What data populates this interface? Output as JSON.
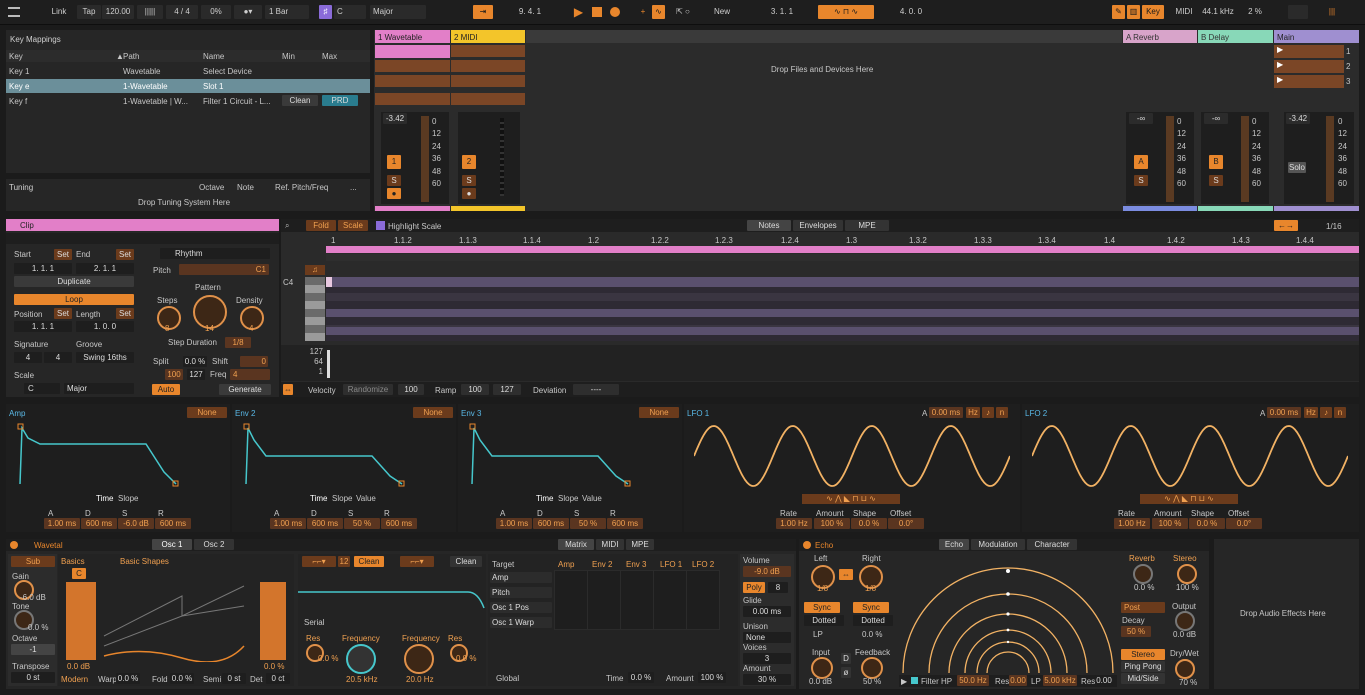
{
  "topbar": {
    "link": "Link",
    "tap": "Tap",
    "bpm": "120.00",
    "sig": "4 / 4",
    "swing": "0%",
    "quant": "1 Bar",
    "key": "C",
    "scale": "Major",
    "pos": "9.  4.  1",
    "new": "New",
    "loop_start": "3.  1.  1",
    "loop_len": "4.  0.  0",
    "key_btn": "Key",
    "midi": "MIDI",
    "rate": "44.1 kHz",
    "cpu": "2 %"
  },
  "keymap": {
    "title": "Key Mappings",
    "cols": [
      "Key",
      "Path",
      "Name",
      "Min",
      "Max"
    ],
    "rows": [
      [
        "Key 1",
        "Wavetable",
        "Select Device",
        "",
        ""
      ],
      [
        "Key e",
        "1-Wavetable",
        "Slot 1",
        "",
        ""
      ],
      [
        "Key f",
        "1-Wavetable | W...",
        "Filter 1 Circuit - L...",
        "Clean",
        "PRD"
      ]
    ]
  },
  "tuning": {
    "title": "Tuning",
    "cols": [
      "Octave",
      "Note",
      "Ref. Pitch/Freq",
      "..."
    ],
    "drop": "Drop Tuning System Here"
  },
  "tracks": {
    "t1": "1 Wavetable",
    "t2": "2 MIDI",
    "drop": "Drop Files and Devices Here",
    "ra": "A Reverb",
    "rb": "B Delay",
    "main": "Main",
    "vol1": "-3.42",
    "vol2": "-∞",
    "vol3": "-∞",
    "vol4": "-3.42",
    "n1": "1",
    "n2": "2",
    "na": "A",
    "nb": "B",
    "s": "S",
    "solo": "Solo",
    "scenes": [
      "1",
      "2",
      "3"
    ],
    "meter": [
      "0",
      "12",
      "24",
      "36",
      "48",
      "60"
    ]
  },
  "clip": {
    "title": "Clip",
    "start": "Start",
    "end": "End",
    "set": "Set",
    "s1": "1.  1.  1",
    "e1": "2.  1.  1",
    "dup": "Duplicate",
    "loop": "Loop",
    "position": "Position",
    "length": "Length",
    "p1": "1.  1.  1",
    "l1": "1.  0.  0",
    "signature": "Signature",
    "groove": "Groove",
    "sig_n": "4",
    "sig_d": "4",
    "swing": "Swing 16ths",
    "scale": "Scale",
    "sk": "C",
    "ss": "Major"
  },
  "rhythm": {
    "mode": "Rhythm",
    "pitch": "Pitch",
    "pitch_v": "C1",
    "steps": "Steps",
    "pattern": "Pattern",
    "density": "Density",
    "steps_v": "8",
    "pattern_v": "14",
    "density_v": "4",
    "step_dur": "Step Duration",
    "step_dur_v": "1/8",
    "split": "Split",
    "split_v": "0.0 %",
    "shift": "Shift",
    "shift_v": "0",
    "v100": "100",
    "v127": "127",
    "freq": "Freq",
    "freq_v": "4",
    "auto": "Auto",
    "gen": "Generate"
  },
  "midi": {
    "fold": "Fold",
    "scale": "Scale",
    "hl": "Highlight Scale",
    "tabs": [
      "Notes",
      "Envelopes",
      "MPE"
    ],
    "grid": "1/16",
    "bars": [
      "1",
      "1.1.2",
      "1.1.3",
      "1.1.4",
      "1.2",
      "1.2.2",
      "1.2.3",
      "1.2.4",
      "1.3",
      "1.3.2",
      "1.3.3",
      "1.3.4",
      "1.4",
      "1.4.2",
      "1.4.3",
      "1.4.4"
    ],
    "note": "C4",
    "vel": [
      "127",
      "64",
      "1"
    ],
    "velocity": "Velocity",
    "randomize": "Randomize",
    "v100": "100",
    "ramp": "Ramp",
    "r100": "100",
    "r127": "127",
    "deviation": "Deviation",
    "dev_v": "----"
  },
  "mods": {
    "env1": "Amp",
    "env2": "Env 2",
    "env3": "Env 3",
    "none": "None",
    "time": "Time",
    "slope": "Slope",
    "value": "Value",
    "A": "A",
    "D": "D",
    "S": "S",
    "R": "R",
    "e1v": [
      "1.00 ms",
      "600 ms",
      "-6.0 dB",
      "600 ms"
    ],
    "e2v": [
      "1.00 ms",
      "600 ms",
      "50 %",
      "600 ms"
    ],
    "e3v": [
      "1.00 ms",
      "600 ms",
      "50 %",
      "600 ms"
    ],
    "lfo1": "LFO 1",
    "lfo2": "LFO 2",
    "la": "A",
    "lav": "0.00 ms",
    "hz": "Hz",
    "rate": "Rate",
    "amount": "Amount",
    "shape": "Shape",
    "offset": "Offset",
    "ratev": "1.00 Hz",
    "amtv": "100 %",
    "shpv": "0.0 %",
    "offv": "0.0°"
  },
  "wt": {
    "title": "Wavetal",
    "osc1": "Osc 1",
    "osc2": "Osc 2",
    "sub": "Sub",
    "gain": "Gain",
    "gain_v": "-6.0 dB",
    "tone": "Tone",
    "tone_v": "0.0 %",
    "octave": "Octave",
    "oct_v": "-1",
    "transpose": "Transpose",
    "trans_v": "0 st",
    "basics": "Basics",
    "shapes": "Basic Shapes",
    "c": "C",
    "osc_v": "0.0 dB",
    "modern": "Modern",
    "warp": "Warp",
    "warp_v": "0.0 %",
    "fold": "Fold",
    "fold_v": "0.0 %",
    "semi": "Semi",
    "semi_v": "0 st",
    "det": "Det",
    "det_v": "0 ct",
    "vol2": "0.0 %",
    "f_num": "12",
    "clean": "Clean",
    "clean2": "Clean",
    "serial": "Serial",
    "res": "Res",
    "res_v": "0.0 %",
    "freq": "Frequency",
    "freq_v": "20.5 kHz",
    "freq2_v": "20.0 Hz",
    "res2_v": "0.0 %",
    "mtabs": [
      "Matrix",
      "MIDI",
      "MPE"
    ],
    "target": "Target",
    "rows": [
      "Amp",
      "Pitch",
      "Osc 1 Pos",
      "Osc 1 Warp"
    ],
    "mcols": [
      "Amp",
      "Env 2",
      "Env 3",
      "LFO 1",
      "LFO 2"
    ],
    "global": "Global",
    "time": "Time",
    "time_v": "0.0 %",
    "amount": "Amount",
    "amount_v": "100 %",
    "volume": "Volume",
    "volume_v": "-9.0 dB",
    "poly": "Poly",
    "voices_n": "8",
    "glide": "Glide",
    "glide_v": "0.00 ms",
    "unison": "Unison",
    "uni_v": "None",
    "voices": "Voices",
    "voices_v": "3",
    "amt": "Amount",
    "amt_v": "30 %"
  },
  "echo": {
    "title": "Echo",
    "tabs": [
      "Echo",
      "Modulation",
      "Character"
    ],
    "left": "Left",
    "right": "Right",
    "l_v": "1/8",
    "r_v": "1/8",
    "sync": "Sync",
    "dotted": "Dotted",
    "lp": "LP",
    "rp": "0.0 %",
    "input": "Input",
    "in_v": "0.0 dB",
    "feedback": "Feedback",
    "fb_v": "50 %",
    "d": "D",
    "reverb": "Reverb",
    "rev_v": "0.0 %",
    "stereo": "Stereo",
    "st_v": "100 %",
    "post": "Post",
    "decay": "Decay",
    "dec_v": "50 %",
    "output": "Output",
    "out_v": "0.0 dB",
    "stereo_b": "Stereo",
    "pingpong": "Ping Pong",
    "midside": "Mid/Side",
    "drywet": "Dry/Wet",
    "dw_v": "70 %",
    "fhp": "Filter HP",
    "fhp_v": "50.0 Hz",
    "res": "Res",
    "res_v": "0.00",
    "lp_v": "5.00 kHz",
    "res2_v": "0.00"
  },
  "drop_fx": "Drop Audio Effects Here"
}
